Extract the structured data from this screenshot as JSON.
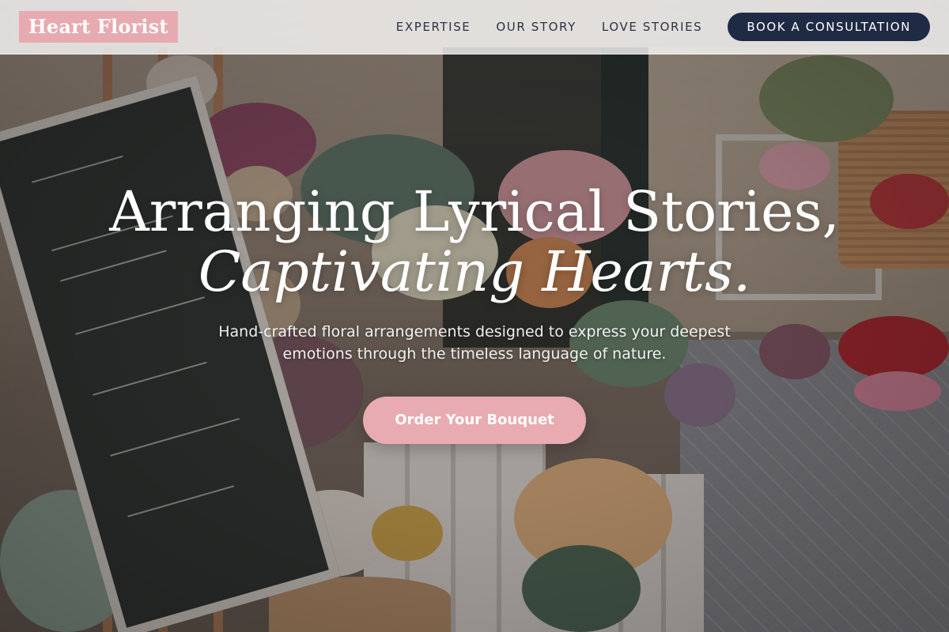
{
  "brand": {
    "name": "Heart Florist",
    "accent_color": "#e7aab0",
    "dark_color": "#1f2a44"
  },
  "nav": {
    "items": [
      {
        "label": "EXPERTISE"
      },
      {
        "label": "OUR STORY"
      },
      {
        "label": "LOVE STORIES"
      }
    ],
    "cta_label": "BOOK A CONSULTATION"
  },
  "hero": {
    "headline_line1": "Arranging Lyrical Stories,",
    "headline_line2": "Captivating Hearts.",
    "subtext": "Hand-crafted floral arrangements designed to express your deepest emotions through the timeless language of nature.",
    "button_label": "Order Your Bouquet"
  }
}
